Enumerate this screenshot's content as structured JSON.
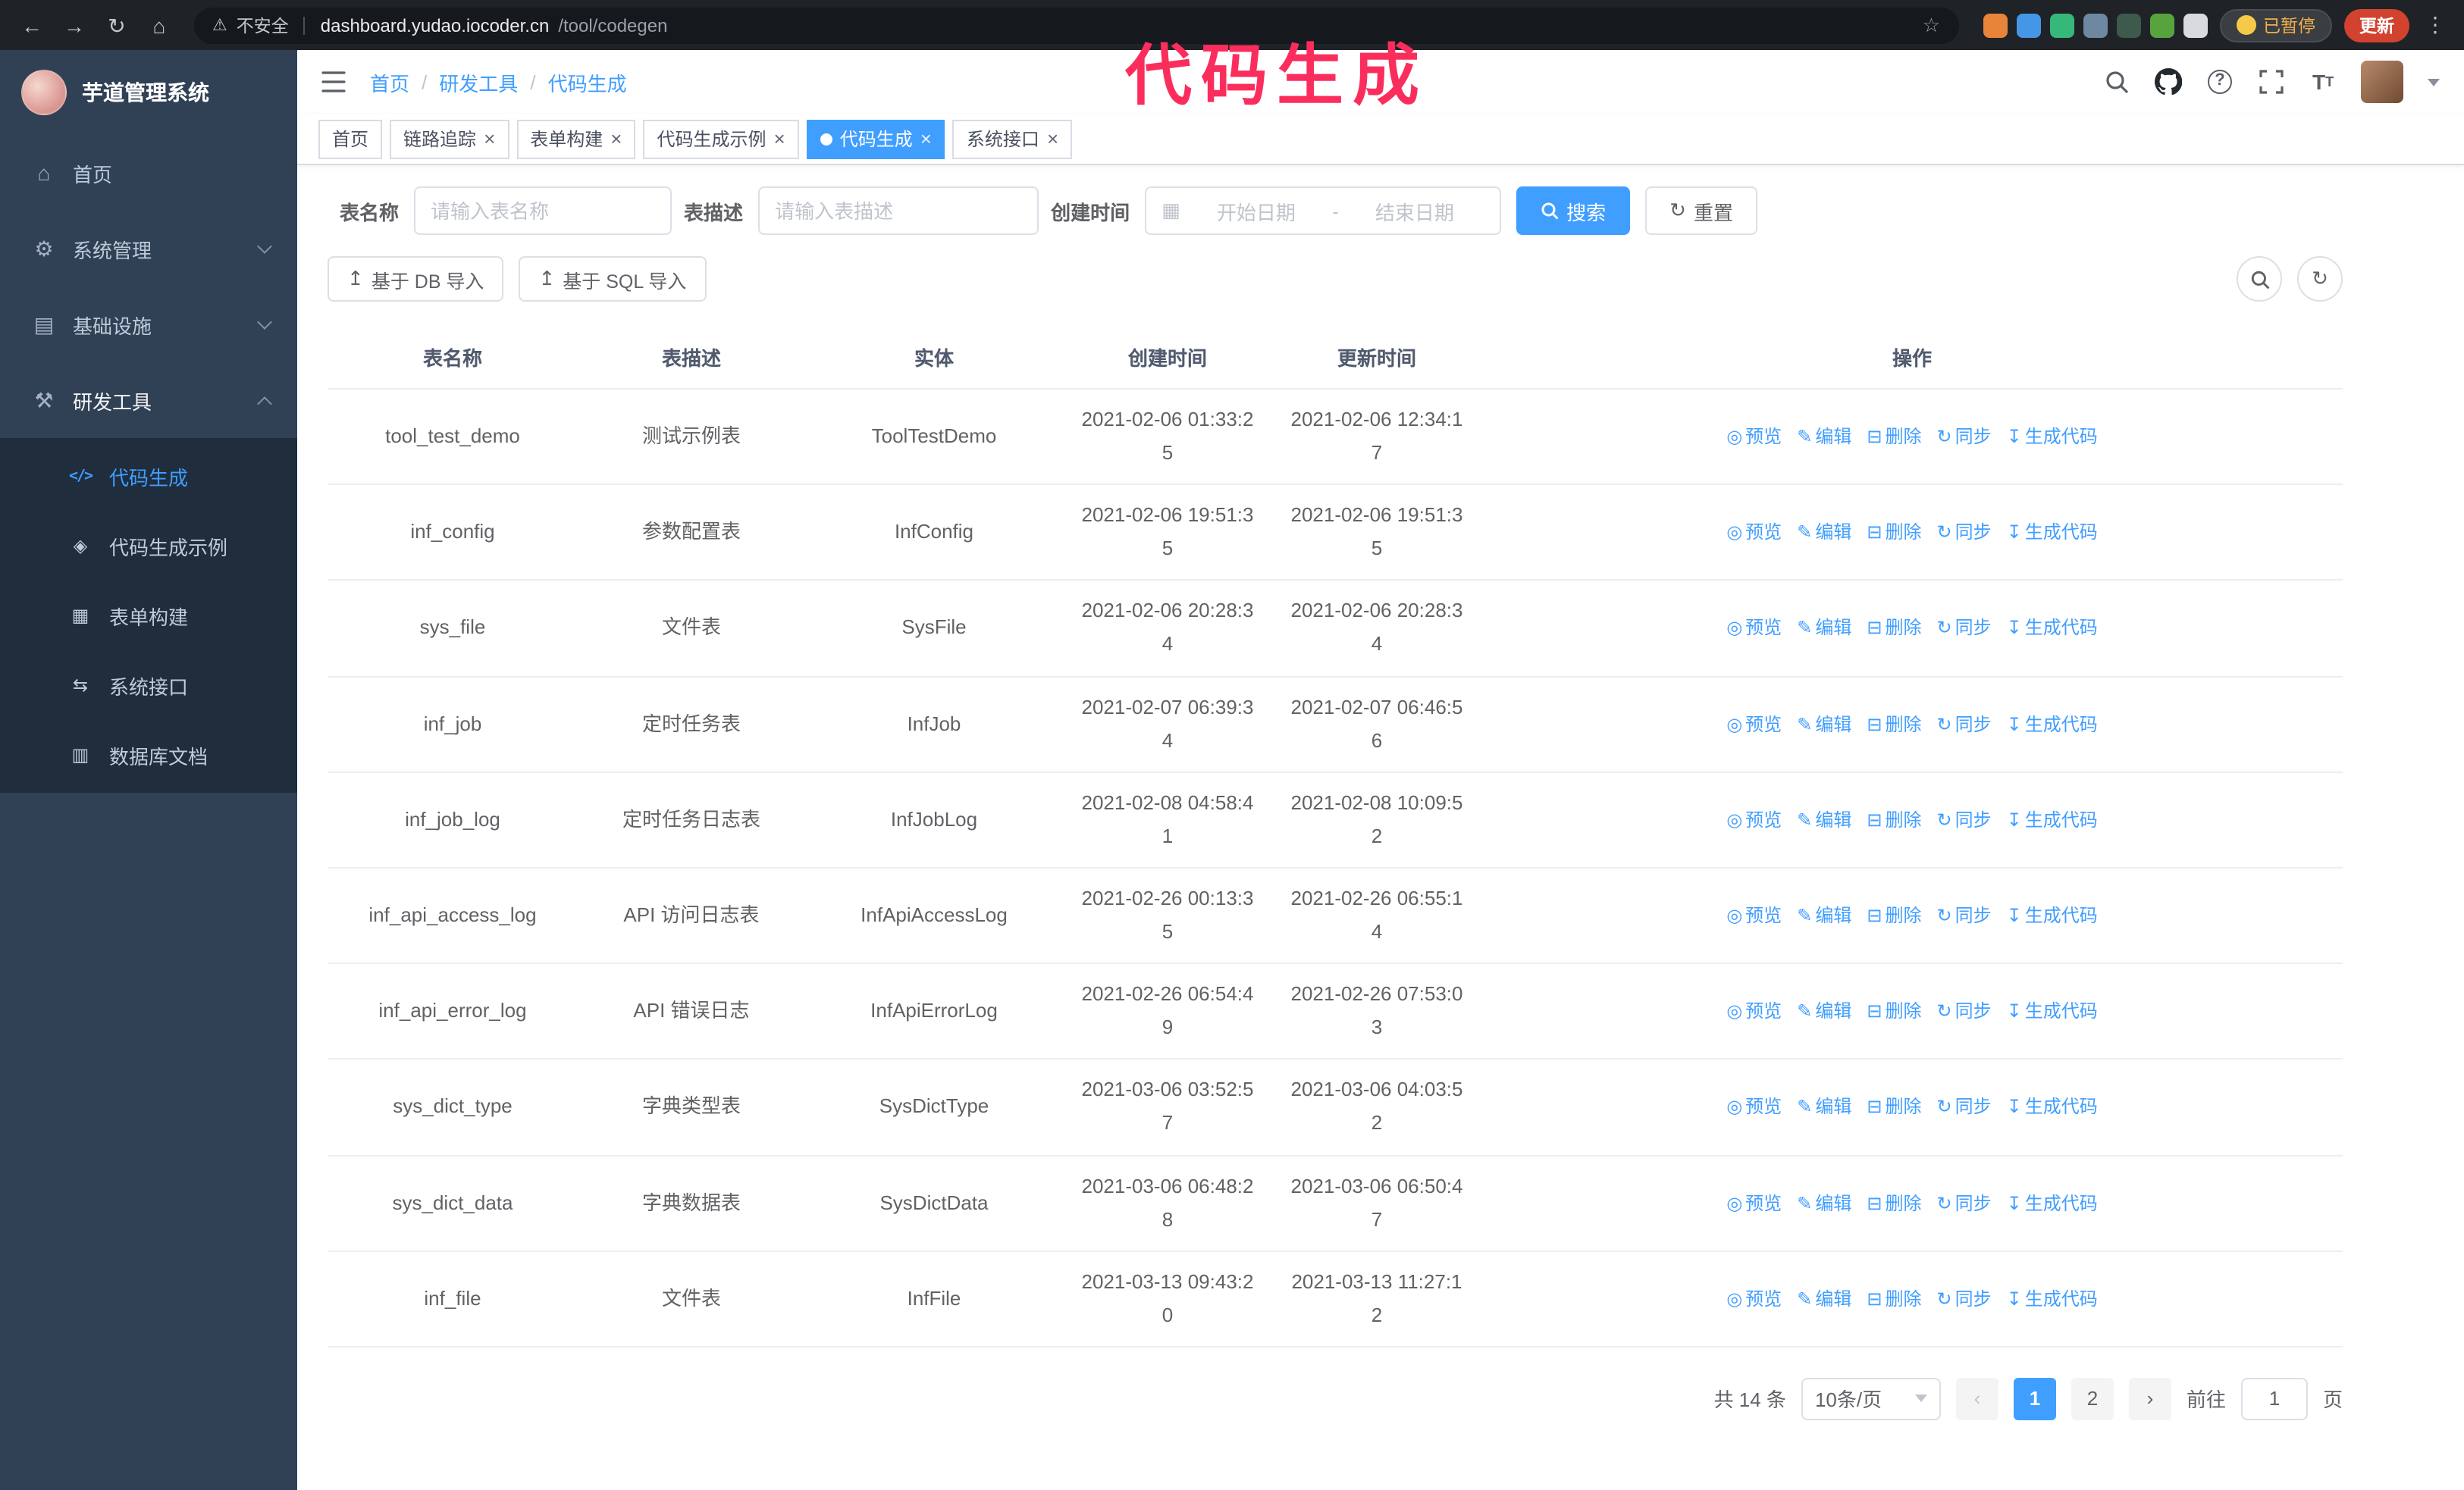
{
  "annotation": {
    "text": "代码生成",
    "color": "#fb2d5d"
  },
  "colors": {
    "accent": "#409eff",
    "sidebar_bg": "#304156",
    "submenu_bg": "#1f2d3d",
    "annotation": "#fb2d5d"
  },
  "browser": {
    "security_label": "不安全",
    "url_host": "dashboard.yudao.iocoder.cn",
    "url_path": "/tool/codegen",
    "paused_badge": "已暂停",
    "update_label": "更新",
    "extensions": [
      {
        "name": "extension-orange-icon",
        "color": "#e8833a"
      },
      {
        "name": "extension-blue-icon",
        "color": "#4596e6"
      },
      {
        "name": "extension-green-check-icon",
        "color": "#35b879"
      },
      {
        "name": "extension-people-icon",
        "color": "#6d88a0"
      },
      {
        "name": "extension-dark-table-icon",
        "color": "#3d5a4c"
      },
      {
        "name": "extension-leaf-icon",
        "color": "#57a33e"
      },
      {
        "name": "extension-paw-icon",
        "color": "#d8dadd"
      }
    ]
  },
  "sidebar": {
    "logo_title": "芋道管理系统",
    "items": [
      {
        "label": "首页"
      },
      {
        "label": "系统管理"
      },
      {
        "label": "基础设施"
      },
      {
        "label": "研发工具"
      }
    ],
    "submenu": [
      {
        "label": "代码生成",
        "active": true
      },
      {
        "label": "代码生成示例"
      },
      {
        "label": "表单构建"
      },
      {
        "label": "系统接口"
      },
      {
        "label": "数据库文档"
      }
    ]
  },
  "breadcrumb": {
    "items": [
      "首页",
      "研发工具",
      "代码生成"
    ]
  },
  "tabs": [
    {
      "label": "首页",
      "closable": false,
      "active": false
    },
    {
      "label": "链路追踪",
      "closable": true,
      "active": false
    },
    {
      "label": "表单构建",
      "closable": true,
      "active": false
    },
    {
      "label": "代码生成示例",
      "closable": true,
      "active": false
    },
    {
      "label": "代码生成",
      "closable": true,
      "active": true
    },
    {
      "label": "系统接口",
      "closable": true,
      "active": false
    }
  ],
  "filter": {
    "name_label": "表名称",
    "name_placeholder": "请输入表名称",
    "desc_label": "表描述",
    "desc_placeholder": "请输入表描述",
    "time_label": "创建时间",
    "start_placeholder": "开始日期",
    "range_separator": "-",
    "end_placeholder": "结束日期",
    "search_label": "搜索",
    "reset_label": "重置"
  },
  "toolbar": {
    "import_db_label": "基于 DB 导入",
    "import_sql_label": "基于 SQL 导入"
  },
  "table": {
    "columns": [
      "表名称",
      "表描述",
      "实体",
      "创建时间",
      "更新时间",
      "操作"
    ],
    "row_actions": [
      {
        "label": "预览",
        "icon": "eye-icon"
      },
      {
        "label": "编辑",
        "icon": "edit-icon"
      },
      {
        "label": "删除",
        "icon": "delete-icon"
      },
      {
        "label": "同步",
        "icon": "sync-icon"
      },
      {
        "label": "生成代码",
        "icon": "download-icon"
      }
    ],
    "rows": [
      {
        "name": "tool_test_demo",
        "description": "测试示例表",
        "entity": "ToolTestDemo",
        "create_time": "2021-02-06 01:33:25",
        "update_time": "2021-02-06 12:34:17"
      },
      {
        "name": "inf_config",
        "description": "参数配置表",
        "entity": "InfConfig",
        "create_time": "2021-02-06 19:51:35",
        "update_time": "2021-02-06 19:51:35"
      },
      {
        "name": "sys_file",
        "description": "文件表",
        "entity": "SysFile",
        "create_time": "2021-02-06 20:28:34",
        "update_time": "2021-02-06 20:28:34"
      },
      {
        "name": "inf_job",
        "description": "定时任务表",
        "entity": "InfJob",
        "create_time": "2021-02-07 06:39:34",
        "update_time": "2021-02-07 06:46:56"
      },
      {
        "name": "inf_job_log",
        "description": "定时任务日志表",
        "entity": "InfJobLog",
        "create_time": "2021-02-08 04:58:41",
        "update_time": "2021-02-08 10:09:52"
      },
      {
        "name": "inf_api_access_log",
        "description": "API 访问日志表",
        "entity": "InfApiAccessLog",
        "create_time": "2021-02-26 00:13:35",
        "update_time": "2021-02-26 06:55:14"
      },
      {
        "name": "inf_api_error_log",
        "description": "API 错误日志",
        "entity": "InfApiErrorLog",
        "create_time": "2021-02-26 06:54:49",
        "update_time": "2021-02-26 07:53:03"
      },
      {
        "name": "sys_dict_type",
        "description": "字典类型表",
        "entity": "SysDictType",
        "create_time": "2021-03-06 03:52:57",
        "update_time": "2021-03-06 04:03:52"
      },
      {
        "name": "sys_dict_data",
        "description": "字典数据表",
        "entity": "SysDictData",
        "create_time": "2021-03-06 06:48:28",
        "update_time": "2021-03-06 06:50:47"
      },
      {
        "name": "inf_file",
        "description": "文件表",
        "entity": "InfFile",
        "create_time": "2021-03-13 09:43:20",
        "update_time": "2021-03-13 11:27:12"
      }
    ]
  },
  "pagination": {
    "total_text": "共 14 条",
    "page_size": "10条/页",
    "pages": [
      "1",
      "2"
    ],
    "current_page": "1",
    "goto_label": "前往",
    "goto_value": "1",
    "goto_suffix": "页"
  }
}
